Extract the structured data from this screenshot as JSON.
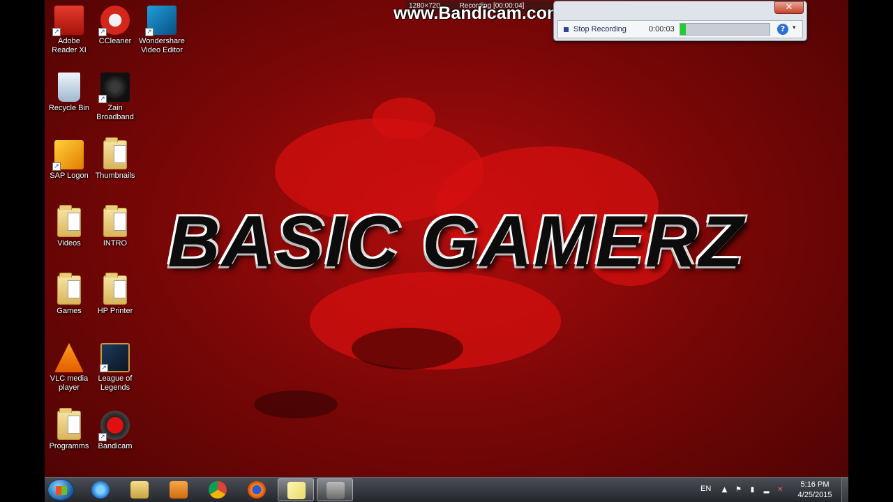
{
  "watermark": "www.Bandicam.com",
  "bandicam": {
    "top_resolution": "1280×720",
    "top_status": "Recording [00:00:04]",
    "close_label": "✕",
    "stop_label": "Stop Recording",
    "elapsed": "0:00:03",
    "meter_level": 0.06,
    "help_label": "?",
    "dropdown_label": "▾"
  },
  "wallpaper": {
    "title": "BASIC GAMERZ",
    "colors": {
      "base": "#7d0707",
      "splatter": "#d40f0f"
    }
  },
  "desktop_icons": [
    {
      "label_lines": [
        "Adobe",
        "Reader XI"
      ],
      "icon": "acrobat-icon"
    },
    {
      "label_lines": [
        "CCleaner"
      ],
      "icon": "ccleaner-icon"
    },
    {
      "label_lines": [
        "Wondershare",
        "Video Editor"
      ],
      "icon": "video-editor-icon"
    },
    {
      "label_lines": [
        "Recycle Bin"
      ],
      "icon": "recycle-bin-icon"
    },
    {
      "label_lines": [
        "Zain",
        "Broadband"
      ],
      "icon": "zain-icon"
    },
    {
      "label_lines": [
        "SAP Logon"
      ],
      "icon": "sap-icon"
    },
    {
      "label_lines": [
        "Thumbnails"
      ],
      "icon": "folder-icon"
    },
    {
      "label_lines": [
        "Videos"
      ],
      "icon": "folder-icon"
    },
    {
      "label_lines": [
        "INTRO"
      ],
      "icon": "folder-icon"
    },
    {
      "label_lines": [
        "Games"
      ],
      "icon": "folder-icon"
    },
    {
      "label_lines": [
        "HP Printer"
      ],
      "icon": "folder-icon"
    },
    {
      "label_lines": [
        "VLC media",
        "player"
      ],
      "icon": "vlc-icon"
    },
    {
      "label_lines": [
        "League of",
        "Legends"
      ],
      "icon": "league-icon"
    },
    {
      "label_lines": [
        "Programms"
      ],
      "icon": "folder-icon"
    },
    {
      "label_lines": [
        "Bandicam"
      ],
      "icon": "bandicam-icon"
    }
  ],
  "taskbar": {
    "apps": [
      "internet-explorer-icon",
      "file-explorer-icon",
      "media-player-icon",
      "chrome-icon",
      "firefox-icon",
      "notes-icon",
      "bandicam-task-icon"
    ],
    "tray": {
      "language": "EN",
      "time": "5:16 PM",
      "date": "4/25/2015"
    }
  }
}
